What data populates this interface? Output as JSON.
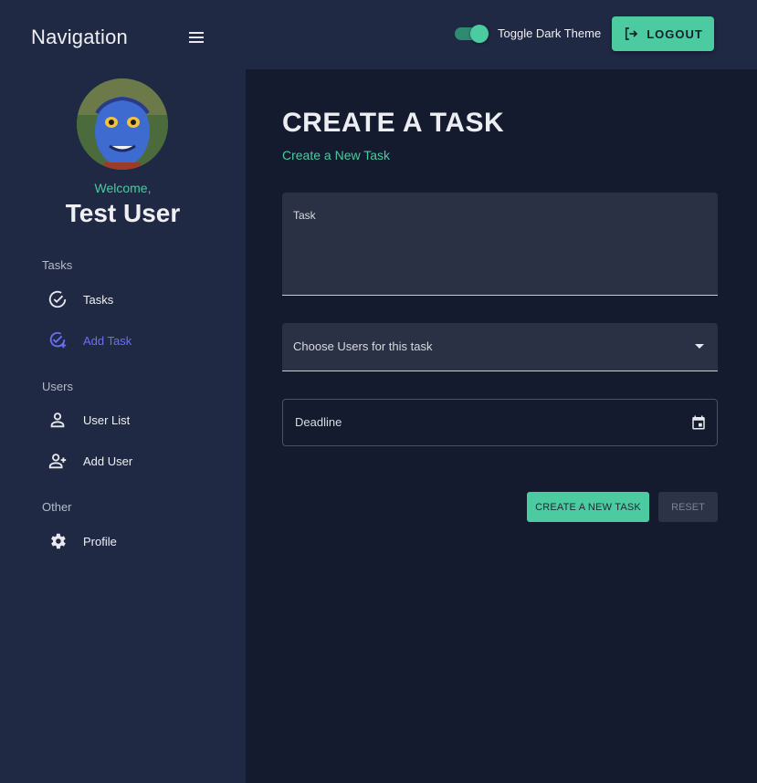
{
  "header": {
    "nav_title": "Navigation",
    "toggle_label": "Toggle Dark Theme",
    "toggle_on": true,
    "logout_label": "LOGOUT"
  },
  "sidebar": {
    "welcome": "Welcome,",
    "username": "Test User",
    "sections": [
      {
        "label": "Tasks",
        "items": [
          {
            "label": "Tasks",
            "icon": "check-circle-icon",
            "active": false
          },
          {
            "label": "Add Task",
            "icon": "add-task-icon",
            "active": true
          }
        ]
      },
      {
        "label": "Users",
        "items": [
          {
            "label": "User List",
            "icon": "person-icon",
            "active": false
          },
          {
            "label": "Add User",
            "icon": "person-add-icon",
            "active": false
          }
        ]
      },
      {
        "label": "Other",
        "items": [
          {
            "label": "Profile",
            "icon": "gear-icon",
            "active": false
          }
        ]
      }
    ]
  },
  "main": {
    "title": "CREATE A TASK",
    "subtitle": "Create a New Task",
    "task_label": "Task",
    "users_label": "Choose Users for this task",
    "deadline_label": "Deadline",
    "create_button": "CREATE A NEW TASK",
    "reset_button": "RESET"
  },
  "colors": {
    "accent": "#4ccaa0",
    "active_link": "#6c6ef5",
    "sidebar_bg": "#1f2943",
    "main_bg": "#151b2e"
  }
}
